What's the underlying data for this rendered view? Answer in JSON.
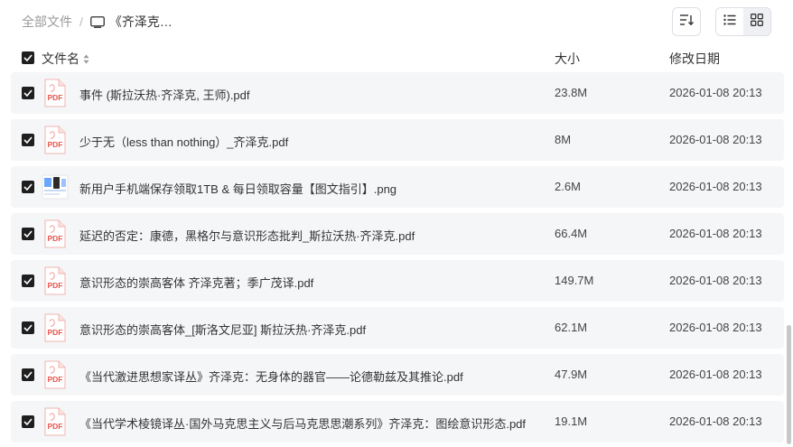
{
  "breadcrumb": {
    "root": "全部文件",
    "separator": "/",
    "current": "《齐泽克…",
    "folder_icon": "book-icon"
  },
  "toolbar": {
    "sort_icon": "sort-icon",
    "list_view_icon": "list-view-icon",
    "grid_view_icon": "grid-view-icon",
    "active_view": "list"
  },
  "table": {
    "columns": {
      "name": "文件名",
      "size": "大小",
      "date": "修改日期"
    },
    "rows": [
      {
        "name": "事件 (斯拉沃热·齐泽克, 王师).pdf",
        "size": "23.8M",
        "date": "2026-01-08 20:13",
        "type": "pdf",
        "checked": true
      },
      {
        "name": "少于无（less than nothing）_齐泽克.pdf",
        "size": "8M",
        "date": "2026-01-08 20:13",
        "type": "pdf",
        "checked": true
      },
      {
        "name": "新用户手机端保存领取1TB & 每日领取容量【图文指引】.png",
        "size": "2.6M",
        "date": "2026-01-08 20:13",
        "type": "png",
        "checked": true
      },
      {
        "name": "延迟的否定：康德，黑格尔与意识形态批判_斯拉沃热·齐泽克.pdf",
        "size": "66.4M",
        "date": "2026-01-08 20:13",
        "type": "pdf",
        "checked": true
      },
      {
        "name": "意识形态的崇高客体 齐泽克著；季广茂译.pdf",
        "size": "149.7M",
        "date": "2026-01-08 20:13",
        "type": "pdf",
        "checked": true
      },
      {
        "name": "意识形态的崇高客体_[斯洛文尼亚] 斯拉沃热·齐泽克.pdf",
        "size": "62.1M",
        "date": "2026-01-08 20:13",
        "type": "pdf",
        "checked": true
      },
      {
        "name": "《当代激进思想家译丛》齐泽克：无身体的器官——论德勒兹及其推论.pdf",
        "size": "47.9M",
        "date": "2026-01-08 20:13",
        "type": "pdf",
        "checked": true
      },
      {
        "name": "《当代学术棱镜译丛·国外马克思主义与后马克思思潮系列》齐泽克：图绘意识形态.pdf",
        "size": "19.1M",
        "date": "2026-01-08 20:13",
        "type": "pdf",
        "checked": true
      }
    ]
  },
  "pdf_badge": "PDF",
  "colors": {
    "pdf_red": "#e8564e",
    "row_bg": "#f5f6f8",
    "checkbox": "#1f1f1f",
    "muted_text": "#999999"
  }
}
